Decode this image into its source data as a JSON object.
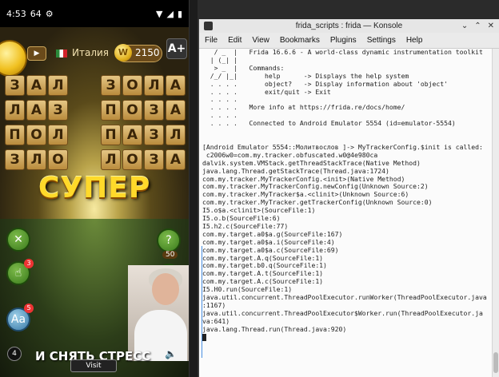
{
  "phone": {
    "status": {
      "time": "4:53",
      "extra": "64"
    },
    "topbar": {
      "country": "Италия",
      "score": "2150",
      "coin_letter": "W",
      "ad_badge": "A+"
    },
    "grid": [
      [
        "ЗАЛ",
        "ЗОЛА"
      ],
      [
        "ЛАЗ",
        "ПОЗА"
      ],
      [
        "ПОЛ",
        "ПАЗЛ"
      ],
      [
        "ЗЛО",
        "ЛОЗА"
      ]
    ],
    "banner": "СУПЕР",
    "side": {
      "hint_count": "50",
      "badge_left": "3",
      "badge_left2": "5",
      "aa_badge": "4"
    },
    "subtitle": "И СНЯТЬ СТРЕСС",
    "visit_label": "Visit",
    "skip_label": "4"
  },
  "konsole": {
    "title": "frida_scripts : frida — Konsole",
    "menu": [
      "File",
      "Edit",
      "View",
      "Bookmarks",
      "Plugins",
      "Settings",
      "Help"
    ],
    "lines": [
      "   / _  |   Frida 16.6.6 - A world-class dynamic instrumentation toolkit",
      "  | (_| |",
      "   > _  |   Commands:",
      "  /_/ |_|       help      -> Displays the help system",
      "  . . . .       object?   -> Display information about 'object'",
      "  . . . .       exit/quit -> Exit",
      "  . . . .",
      "  . . . .   More info at https://frida.re/docs/home/",
      "  . . . .",
      "  . . . .   Connected to Android Emulator 5554 (id=emulator-5554)",
      "",
      "",
      "[Android Emulator 5554::Молитвослов ]-> MyTrackerConfig.$init is called:",
      " c2006w0=com.my.tracker.obfuscated.w0@4e980ca",
      "dalvik.system.VMStack.getThreadStackTrace(Native Method)",
      "java.lang.Thread.getStackTrace(Thread.java:1724)",
      "com.my.tracker.MyTrackerConfig.<init>(Native Method)",
      "com.my.tracker.MyTrackerConfig.newConfig(Unknown Source:2)",
      "com.my.tracker.MyTracker$a.<clinit>(Unknown Source:6)",
      "com.my.tracker.MyTracker.getTrackerConfig(Unknown Source:0)",
      "I5.o$a.<clinit>(SourceFile:1)",
      "I5.o.b(SourceFile:6)",
      "I5.h2.c(SourceFile:77)",
      "com.my.target.a0$a.g(SourceFile:167)",
      "com.my.target.a0$a.i(SourceFile:4)",
      "com.my.target.a0$a.c(SourceFile:69)",
      "com.my.target.A.q(SourceFile:1)",
      "com.my.target.b0.q(SourceFile:1)",
      "com.my.target.A.t(SourceFile:1)",
      "com.my.target.A.c(SourceFile:1)",
      "I5.H0.run(SourceFile:1)",
      "java.util.concurrent.ThreadPoolExecutor.runWorker(ThreadPoolExecutor.java",
      ":1167)",
      "java.util.concurrent.ThreadPoolExecutor$Worker.run(ThreadPoolExecutor.ja",
      "va:641)",
      "java.lang.Thread.run(Thread.java:920)"
    ]
  }
}
